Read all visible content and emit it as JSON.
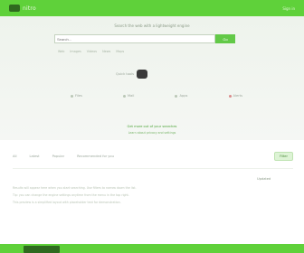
{
  "brand": {
    "logo_text": "nitro",
    "accent": "#5fd13a",
    "dark": "#2f6a1f"
  },
  "topbar": {
    "right_text": "Sign in"
  },
  "hero": {
    "title": "Search the web with a lightweight engine",
    "search": {
      "placeholder": "Search...",
      "button_label": "Go"
    },
    "links": [
      "Web",
      "Images",
      "Videos",
      "News",
      "Maps"
    ]
  },
  "chip": {
    "label": "Quick tools"
  },
  "nav": {
    "items": [
      {
        "label": "Files",
        "dot": "gray"
      },
      {
        "label": "Mail",
        "dot": "gray"
      },
      {
        "label": "Apps",
        "dot": "gray"
      },
      {
        "label": "Alerts",
        "dot": "red"
      }
    ]
  },
  "promo": {
    "line1": "Get more out of your searches",
    "line2": "Learn about privacy and settings"
  },
  "filters": {
    "items": [
      "All",
      "Latest",
      "Popular",
      "Recommended for you"
    ],
    "button_label": "Filter"
  },
  "content": {
    "note": "Updated",
    "lines": [
      "Results will appear here when you start searching. Use filters to narrow down the list.",
      "Tip: you can change the engine settings anytime from the menu in the top right.",
      "This preview is a simplified layout with placeholder text for demonstration."
    ]
  },
  "footer": {
    "tab_label": ""
  }
}
